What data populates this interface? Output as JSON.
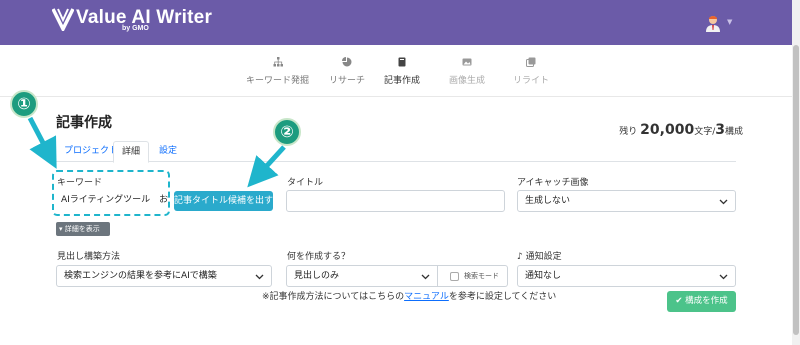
{
  "header": {
    "logo_text": "Value AI Writer",
    "logo_by": "by GMO",
    "accent": "#6b5ba8"
  },
  "nav": [
    {
      "label": "キーワード発掘",
      "icon": "sitemap-icon",
      "state": "normal"
    },
    {
      "label": "リサーチ",
      "icon": "pie-chart-icon",
      "state": "normal"
    },
    {
      "label": "記事作成",
      "icon": "book-icon",
      "state": "active"
    },
    {
      "label": "画像生成",
      "icon": "image-icon",
      "state": "disabled"
    },
    {
      "label": "リライト",
      "icon": "copy-icon",
      "state": "disabled"
    }
  ],
  "page": {
    "title": "記事作成",
    "remain_prefix": "残り",
    "remain_chars": "20,000",
    "remain_unit": "文字/",
    "remain_count": "3",
    "remain_suffix": "構成"
  },
  "tabs": [
    {
      "label": "プロジェクト",
      "active": false
    },
    {
      "label": "詳細",
      "active": true
    },
    {
      "label": "設定",
      "active": false
    }
  ],
  "form": {
    "keyword_label": "キーワード",
    "keyword_value": "AIライティングツール　おすすめ",
    "title_candidates_button": "記事タイトル候補を出す",
    "title_label": "タイトル",
    "title_value": "",
    "eyecatch_label": "アイキャッチ画像",
    "eyecatch_value": "生成しない",
    "detail_toggle": "詳細を表示",
    "heading_method_label": "見出し構築方法",
    "heading_method_value": "検索エンジンの結果を参考にAIで構築",
    "create_what_label": "何を作成する？",
    "create_what_value": "見出しのみ",
    "search_mode_label": "検索モード",
    "notify_label": "通知設定",
    "notify_value": "通知なし",
    "note_prefix": "※記事作成方法についてはこちらの",
    "note_link": "マニュアル",
    "note_suffix": "を参考に設定してください",
    "create_button": "構成を作成"
  },
  "annotations": {
    "badge_1": "①",
    "badge_2": "②",
    "color": "#1fb5cc"
  }
}
